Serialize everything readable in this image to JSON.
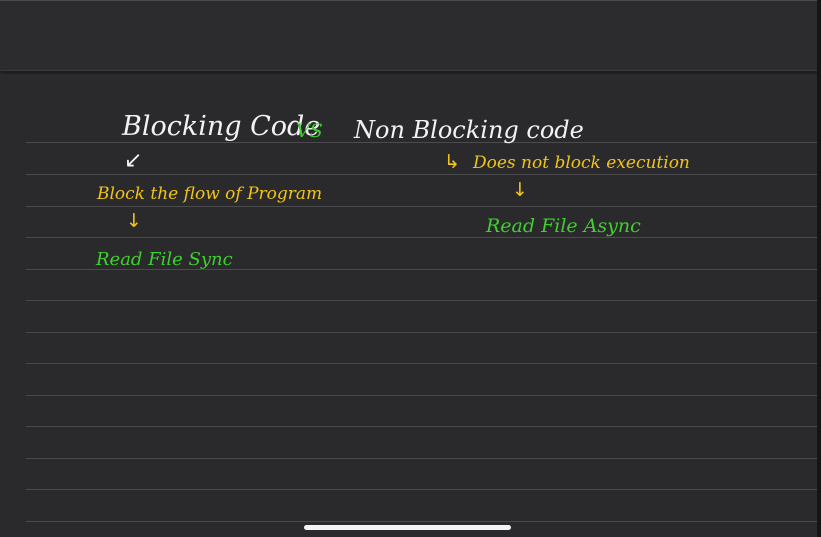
{
  "notes": {
    "title_left": "Blocking Code",
    "title_vs": "VS",
    "title_right": "Non Blocking code",
    "left_point_1": "Block the flow of Program",
    "left_point_2": "Read File Sync",
    "right_point_1": "Does not block execution",
    "right_point_2": "Read File Async"
  },
  "icons": {
    "down_arrow": "down-arrow-icon",
    "hook_arrow": "hook-right-arrow-icon"
  },
  "colors": {
    "background": "#2a2a2c",
    "white_ink": "#f2f2f2",
    "green_ink": "#3fcf2f",
    "yellow_ink": "#f0c419",
    "rule_line": "#4b4b4e"
  }
}
